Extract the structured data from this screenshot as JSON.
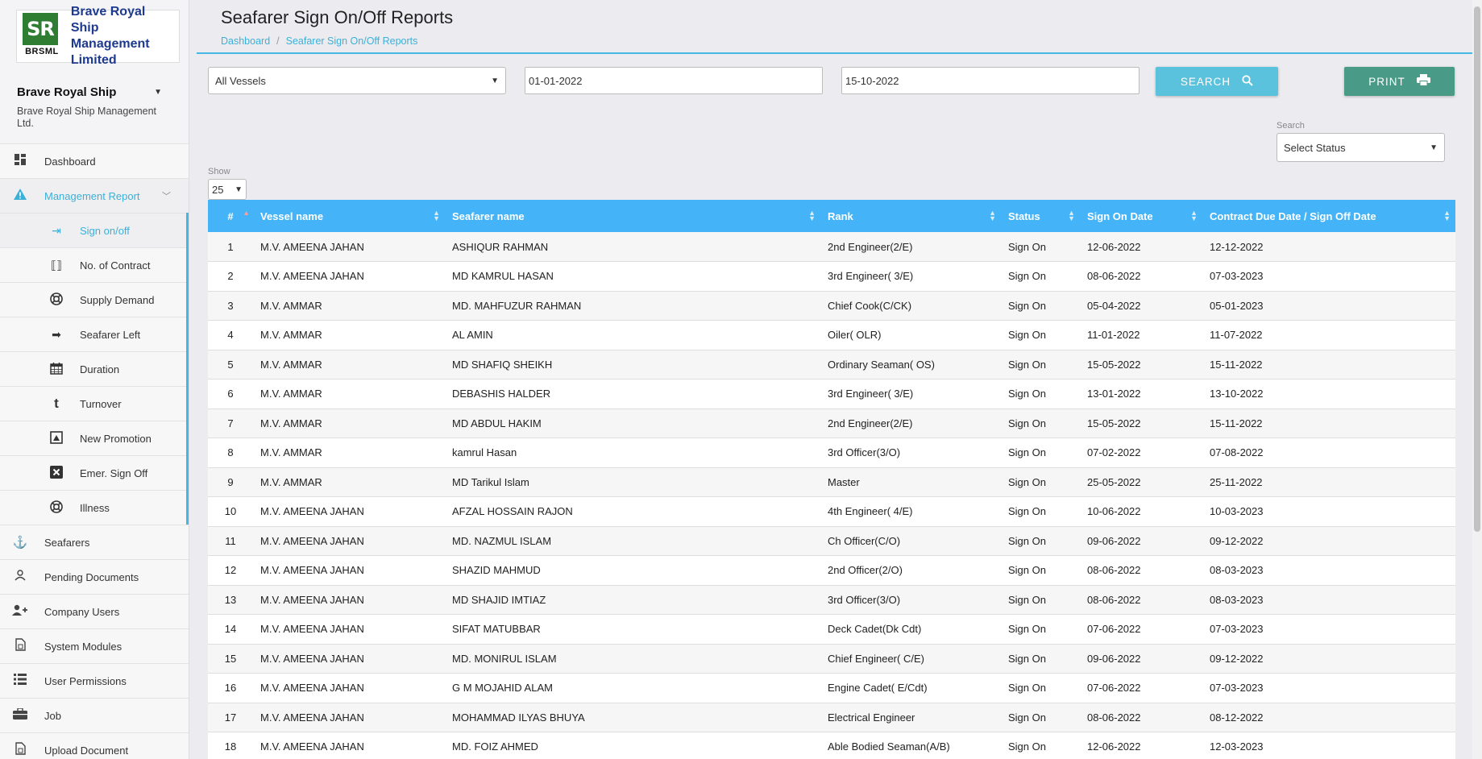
{
  "brand": {
    "badge": "SR",
    "badge_sub": "BRSML",
    "line1": "Brave Royal Ship",
    "line2": "Management",
    "line3": "Limited"
  },
  "org": {
    "name": "Brave Royal Ship",
    "subtitle": "Brave Royal Ship Management Ltd."
  },
  "sidebar": {
    "dashboard": "Dashboard",
    "management_report": "Management Report",
    "sub_items": [
      {
        "label": "Sign on/off",
        "icon": "sign-in-icon"
      },
      {
        "label": "No. of Contract",
        "icon": "contract-icon"
      },
      {
        "label": "Supply Demand",
        "icon": "lifebuoy-icon"
      },
      {
        "label": "Seafarer Left",
        "icon": "sign-out-icon"
      },
      {
        "label": "Duration",
        "icon": "calendar-icon"
      },
      {
        "label": "Turnover",
        "icon": "tumblr-icon"
      },
      {
        "label": "New Promotion",
        "icon": "image-icon"
      },
      {
        "label": "Emer. Sign Off",
        "icon": "close-square-icon"
      },
      {
        "label": "Illness",
        "icon": "lifebuoy-icon"
      }
    ],
    "items": [
      {
        "label": "Seafarers",
        "icon": "anchor-icon"
      },
      {
        "label": "Pending Documents",
        "icon": "user-icon"
      },
      {
        "label": "Company Users",
        "icon": "add-user-icon"
      },
      {
        "label": "System Modules",
        "icon": "file-icon"
      },
      {
        "label": "User Permissions",
        "icon": "list-icon"
      },
      {
        "label": "Job",
        "icon": "briefcase-icon"
      },
      {
        "label": "Upload Document",
        "icon": "file-icon"
      }
    ]
  },
  "header": {
    "title": "Seafarer Sign On/Off Reports",
    "breadcrumb_home": "Dashboard",
    "breadcrumb_current": "Seafarer Sign On/Off Reports"
  },
  "filters": {
    "vessel": "All Vessels",
    "from_date": "01-01-2022",
    "to_date": "15-10-2022",
    "search_label": "SEARCH",
    "print_label": "PRINT",
    "status_label": "Search",
    "status_value": "Select Status",
    "show_label": "Show",
    "show_value": "25"
  },
  "table": {
    "columns": [
      "#",
      "Vessel name",
      "Seafarer name",
      "Rank",
      "Status",
      "Sign On Date",
      "Contract Due Date / Sign Off Date"
    ],
    "rows": [
      [
        "1",
        "M.V. AMEENA JAHAN",
        "ASHIQUR RAHMAN",
        "2nd Engineer(2/E)",
        "Sign On",
        "12-06-2022",
        "12-12-2022"
      ],
      [
        "2",
        "M.V. AMEENA JAHAN",
        "MD KAMRUL HASAN",
        "3rd Engineer( 3/E)",
        "Sign On",
        "08-06-2022",
        "07-03-2023"
      ],
      [
        "3",
        "M.V. AMMAR",
        "MD. MAHFUZUR RAHMAN",
        "Chief Cook(C/CK)",
        "Sign On",
        "05-04-2022",
        "05-01-2023"
      ],
      [
        "4",
        "M.V. AMMAR",
        "AL AMIN",
        "Oiler( OLR)",
        "Sign On",
        "11-01-2022",
        "11-07-2022"
      ],
      [
        "5",
        "M.V. AMMAR",
        "MD SHAFIQ SHEIKH",
        "Ordinary Seaman( OS)",
        "Sign On",
        "15-05-2022",
        "15-11-2022"
      ],
      [
        "6",
        "M.V. AMMAR",
        "DEBASHIS HALDER",
        "3rd Engineer( 3/E)",
        "Sign On",
        "13-01-2022",
        "13-10-2022"
      ],
      [
        "7",
        "M.V. AMMAR",
        "MD ABDUL HAKIM",
        "2nd Engineer(2/E)",
        "Sign On",
        "15-05-2022",
        "15-11-2022"
      ],
      [
        "8",
        "M.V. AMMAR",
        "kamrul Hasan",
        "3rd Officer(3/O)",
        "Sign On",
        "07-02-2022",
        "07-08-2022"
      ],
      [
        "9",
        "M.V. AMMAR",
        "MD Tarikul Islam",
        "Master",
        "Sign On",
        "25-05-2022",
        "25-11-2022"
      ],
      [
        "10",
        "M.V. AMEENA JAHAN",
        "AFZAL HOSSAIN RAJON",
        "4th Engineer( 4/E)",
        "Sign On",
        "10-06-2022",
        "10-03-2023"
      ],
      [
        "11",
        "M.V. AMEENA JAHAN",
        "MD. NAZMUL ISLAM",
        "Ch Officer(C/O)",
        "Sign On",
        "09-06-2022",
        "09-12-2022"
      ],
      [
        "12",
        "M.V. AMEENA JAHAN",
        "SHAZID MAHMUD",
        "2nd Officer(2/O)",
        "Sign On",
        "08-06-2022",
        "08-03-2023"
      ],
      [
        "13",
        "M.V. AMEENA JAHAN",
        "MD SHAJID IMTIAZ",
        "3rd Officer(3/O)",
        "Sign On",
        "08-06-2022",
        "08-03-2023"
      ],
      [
        "14",
        "M.V. AMEENA JAHAN",
        "SIFAT MATUBBAR",
        "Deck Cadet(Dk Cdt)",
        "Sign On",
        "07-06-2022",
        "07-03-2023"
      ],
      [
        "15",
        "M.V. AMEENA JAHAN",
        "MD. MONIRUL ISLAM",
        "Chief Engineer( C/E)",
        "Sign On",
        "09-06-2022",
        "09-12-2022"
      ],
      [
        "16",
        "M.V. AMEENA JAHAN",
        "G M MOJAHID ALAM",
        "Engine Cadet( E/Cdt)",
        "Sign On",
        "07-06-2022",
        "07-03-2023"
      ],
      [
        "17",
        "M.V. AMEENA JAHAN",
        "MOHAMMAD ILYAS BHUYA",
        "Electrical Engineer",
        "Sign On",
        "08-06-2022",
        "08-12-2022"
      ],
      [
        "18",
        "M.V. AMEENA JAHAN",
        "MD. FOIZ AHMED",
        "Able Bodied Seaman(A/B)",
        "Sign On",
        "12-06-2022",
        "12-03-2023"
      ]
    ]
  },
  "colors": {
    "accent": "#3bb0d8",
    "table_header": "#45b3f7",
    "search_button": "#5bc2dd",
    "print_button": "#4a9a88",
    "brand_green": "#2e7d32",
    "brand_blue": "#1d3a8f"
  }
}
